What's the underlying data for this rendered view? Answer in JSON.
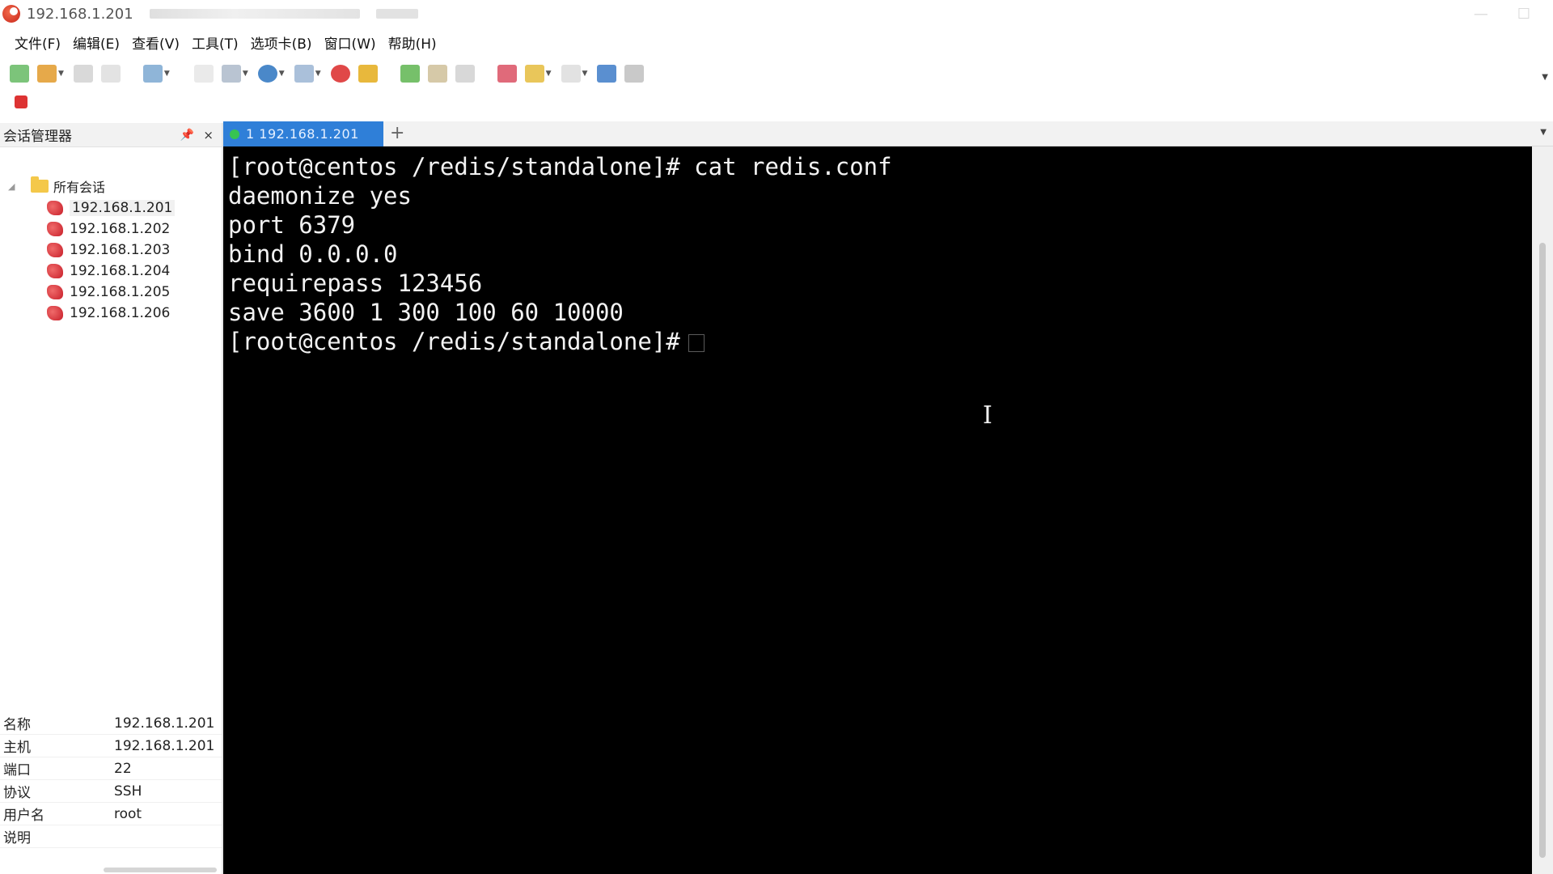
{
  "window": {
    "title": "192.168.1.201",
    "colors": {
      "accent": "#2f7fd8",
      "terminal_bg": "#000000",
      "terminal_fg": "#f2f2f2",
      "connected": "#37c453"
    }
  },
  "menu": [
    "文件(F)",
    "编辑(E)",
    "查看(V)",
    "工具(T)",
    "选项卡(B)",
    "窗口(W)",
    "帮助(H)"
  ],
  "session_manager": {
    "title": "会话管理器",
    "root": "所有会话",
    "sessions": [
      "192.168.1.201",
      "192.168.1.202",
      "192.168.1.203",
      "192.168.1.204",
      "192.168.1.205",
      "192.168.1.206"
    ],
    "selected": "192.168.1.201",
    "properties": [
      {
        "key": "名称",
        "value": "192.168.1.201"
      },
      {
        "key": "主机",
        "value": "192.168.1.201"
      },
      {
        "key": "端口",
        "value": "22"
      },
      {
        "key": "协议",
        "value": "SSH"
      },
      {
        "key": "用户名",
        "value": "root"
      },
      {
        "key": "说明",
        "value": ""
      }
    ]
  },
  "tabs": [
    {
      "label": "1 192.168.1.201",
      "active": true,
      "status": "connected"
    }
  ],
  "terminal": {
    "lines": [
      "[root@centos /redis/standalone]# cat redis.conf",
      "daemonize yes",
      "port 6379",
      "bind 0.0.0.0",
      "requirepass 123456",
      "save 3600 1 300 100 60 10000",
      "[root@centos /redis/standalone]#"
    ]
  },
  "icons": {
    "toolbar": [
      "connect-icon",
      "quick-connect-icon",
      "reconnect-icon",
      "disconnect-icon",
      "new-session-icon",
      "globe-icon",
      "find-icon",
      "lock-icon",
      "print-icon",
      "sftp-icon",
      "transfer-icon",
      "settings-icon",
      "color-icon",
      "keymap-icon",
      "script-icon",
      "help-icon",
      "list-icon"
    ]
  }
}
